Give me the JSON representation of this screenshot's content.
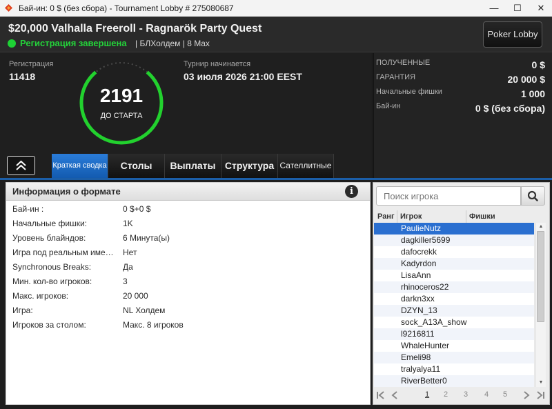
{
  "window": {
    "title": "Бай-ин: 0 $ (без сбора) - Tournament Lobby # 275080687",
    "minimize_glyph": "—",
    "maximize_glyph": "☐",
    "close_glyph": "✕"
  },
  "header": {
    "tournament_name": "$20,000 Valhalla Freeroll - Ragnarök Party Quest",
    "status": "Регистрация завершена",
    "game_info": "| БЛХолдем | 8 Max",
    "lobby_button": "Poker Lobby",
    "status_color": "#1ed235"
  },
  "info": {
    "registration_label": "Регистрация",
    "registration_value": "11418",
    "countdown_value": "2191",
    "countdown_label": "ДО СТАРТА",
    "start_label": "Турнир начинается",
    "start_value": "03 июля 2026  21:00 EEST"
  },
  "prize": {
    "rows": [
      {
        "label": "ПОЛУЧЕННЫЕ",
        "value": "0 $"
      },
      {
        "label": "ГАРАНТИЯ",
        "value": "20 000 $"
      },
      {
        "label": "Начальные фишки",
        "value": "1 000"
      },
      {
        "label": "Бай-ин",
        "value": "0 $ (без сбора)"
      }
    ]
  },
  "tabs": [
    {
      "label": "Краткая сводка",
      "active": true
    },
    {
      "label": "Столы",
      "active": false
    },
    {
      "label": "Выплаты",
      "active": false
    },
    {
      "label": "Структура",
      "active": false
    },
    {
      "label": "Сателлитные",
      "active": false
    }
  ],
  "format": {
    "title": "Информация о формате",
    "info_glyph": "i",
    "rows": [
      {
        "label": "Бай-ин :",
        "value": "0 $+0 $"
      },
      {
        "label": "Начальные фишки:",
        "value": "1K"
      },
      {
        "label": "Уровень блайндов:",
        "value": "6 Минута(ы)"
      },
      {
        "label": "Игра под реальным именем:",
        "value": "Нет"
      },
      {
        "label": "Synchronous Breaks:",
        "value": "Да"
      },
      {
        "label": "Мин. кол-во игроков:",
        "value": "3"
      },
      {
        "label": "Макс. игроков:",
        "value": "20 000"
      },
      {
        "label": "Игра:",
        "value": "NL Холдем"
      },
      {
        "label": "Игроков за столом:",
        "value": "Макс. 8 игроков"
      }
    ]
  },
  "players": {
    "search_placeholder": "Поиск игрока",
    "columns": [
      "Ранг",
      "Игрок",
      "Фишки"
    ],
    "list": [
      "PaulieNutz",
      "dagkiller5699",
      "dafocrekk",
      "Kadyrdon",
      "LisaAnn",
      "rhinoceros22",
      "darkn3xx",
      "DZYN_13",
      "sock_A13A_show",
      "l9216811",
      "WhaleHunter",
      "Emeli98",
      "tralyalya11",
      "RiverBetter0"
    ],
    "selected_index": 0,
    "scrollbar_up_glyph": "▲",
    "scrollbar_down_glyph": "▼",
    "pages": [
      "1",
      "2",
      "3",
      "4",
      "5"
    ],
    "current_page": "1"
  }
}
